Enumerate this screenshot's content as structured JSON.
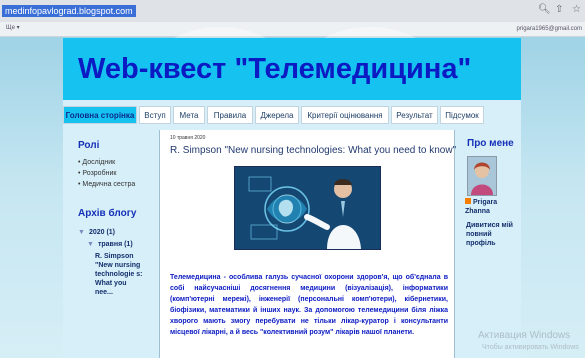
{
  "browser": {
    "url": "medinfopavlograd.blogspot.com",
    "icons": [
      "zoom-icon",
      "share-icon",
      "bookmark-star-icon"
    ],
    "accent": "#3a6fd8"
  },
  "blogger_bar": {
    "share_label": "Ще ▾",
    "email": "prigara1965@gmail.com"
  },
  "header": {
    "title": "Web-квест \"Телемедицина\"",
    "bg_color": "#16c2f0",
    "title_color": "#0b1ac2"
  },
  "tabs": [
    {
      "label": "Головна сторінка",
      "active": true
    },
    {
      "label": "Вступ"
    },
    {
      "label": "Мета"
    },
    {
      "label": "Правила"
    },
    {
      "label": "Джерела"
    },
    {
      "label": "Критерії оцінювання"
    },
    {
      "label": "Результат"
    },
    {
      "label": "Підсумок"
    }
  ],
  "left": {
    "roles_title": "Ролі",
    "roles": [
      "Дослідник",
      "Розробник",
      "Медична сестра"
    ],
    "archive_title": "Архів блогу",
    "archive_year": "2020 (1)",
    "archive_month": "травня (1)",
    "archive_post": "R. Simpson \"New nursing technologie s: What you nee..."
  },
  "post": {
    "date": "10 травня 2020",
    "title": "R. Simpson \"New nursing technologies: What you need to know\"",
    "body": "Телемедицина - особлива галузь сучасної охорони здоров'я, що об'єднала в собі найсучасніші досягнення медицини (візуалізація), інформатики (комп'ютерні мережі), інженерії (персональні комп'ютери), кібернетики, біофізики, математики й інших наук. За допомогою телемедицини біля ліжка хворого мають змогу перебувати не тільки лікар-куратор і консультанти місцевої лікарні, а й весь \"колективний розум\" лікарів нашої планети."
  },
  "right": {
    "about_title": "Про мене",
    "profile_name": "Prigara Zhanna",
    "profile_link": "Дивитися мій повний профіль"
  },
  "watermark": {
    "line1": "Активация Windows",
    "line2": "Чтобы активировать Windows"
  }
}
